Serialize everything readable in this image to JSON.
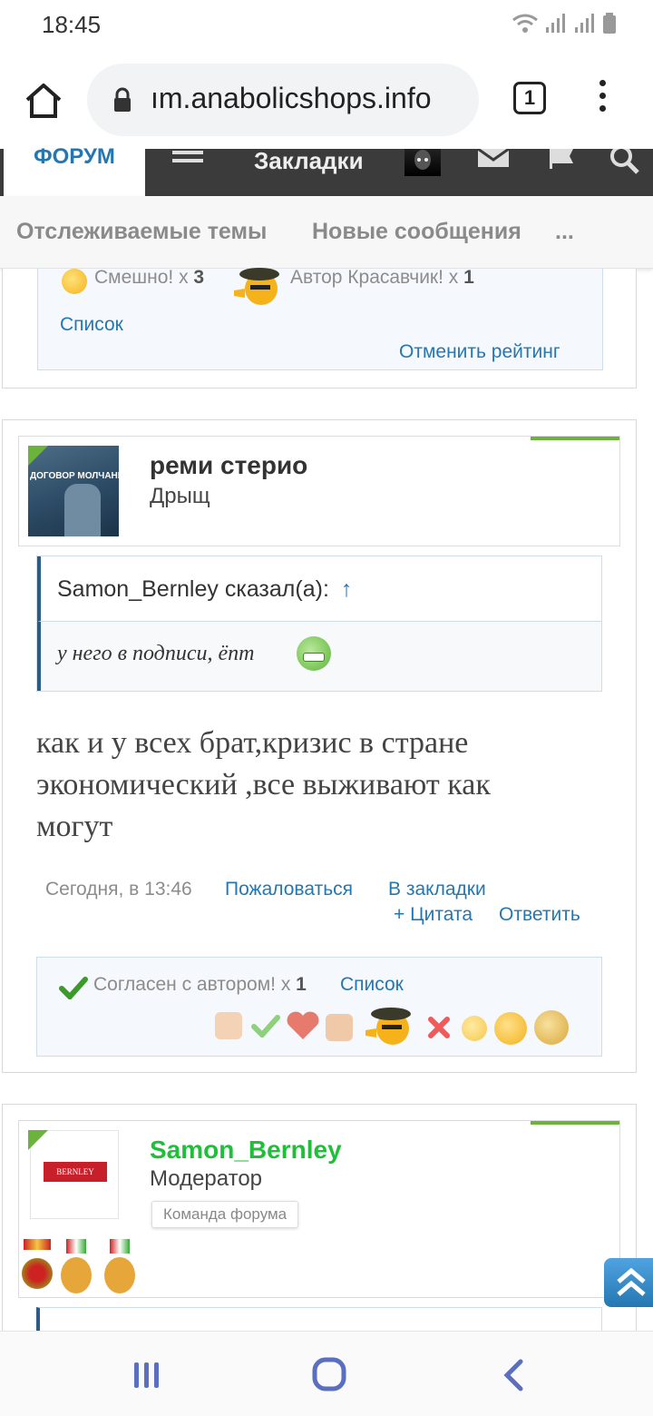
{
  "status_bar": {
    "time": "18:45"
  },
  "browser": {
    "url": "ım.anabolicshops.info",
    "tab_count": "1"
  },
  "forum_nav": {
    "forum_tab": "ФОРУМ",
    "bookmarks": "Закладки"
  },
  "sub_nav": {
    "items": [
      "Отслеживаемые темы",
      "Новые сообщения",
      "..."
    ]
  },
  "post1_footer": {
    "reaction_1_label": "Смешно! x",
    "reaction_1_count": "3",
    "reaction_2_label": "Автор Красавчик! x",
    "reaction_2_count": "1",
    "list_link": "Список",
    "cancel_rating": "Отменить рейтинг"
  },
  "post2": {
    "author": "реми стерио",
    "rank": "Дрыщ",
    "avatar_caption": "ДОГОВОР МОЛЧАНИЯ",
    "quote_author": "Samon_Bernley сказал(а):",
    "quote_arrow": "↑",
    "quote_text": "у него в подписи, ёпт",
    "message_line1": "как и у всех брат,кризис в стране",
    "message_line2": "экономический ,все выживают как",
    "message_line3": "могут",
    "date": "Сегодня, в 13:46",
    "report": "Пожаловаться",
    "bookmark": "В закладки",
    "quote_btn": "+ Цитата",
    "reply_btn": "Ответить",
    "reaction_label": "Согласен с автором! x",
    "reaction_count": "1",
    "list_link": "Список"
  },
  "post3": {
    "author": "Samon_Bernley",
    "rank": "Модератор",
    "team_badge": "Команда форума",
    "avatar_caption": "BERNLEY"
  },
  "colors": {
    "link": "#2577b1",
    "moderator_name": "#1fbf3a",
    "nav_bg": "#3b3b3b",
    "green_accent": "#6cb33e"
  }
}
